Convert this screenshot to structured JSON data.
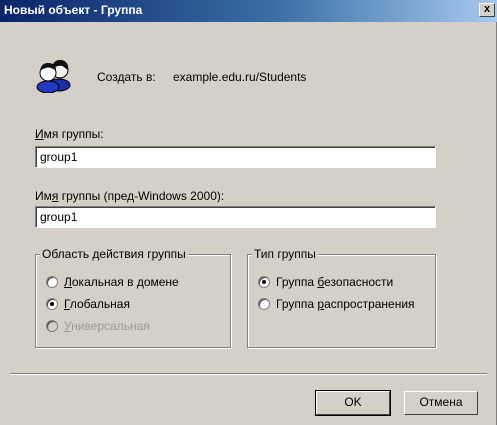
{
  "window": {
    "title": "Новый объект - Группа",
    "close_label": "x"
  },
  "header": {
    "icon": "group-users-icon",
    "create_label": "Создать в:",
    "create_path": "example.edu.ru/Students"
  },
  "fields": {
    "group_name": {
      "label_pre": "",
      "label_ul": "И",
      "label_post": "мя группы:",
      "value": "group1"
    },
    "group_name_legacy": {
      "label_pre": "Им",
      "label_ul": "я",
      "label_post": " группы (пред-Windows 2000):",
      "value": "group1"
    }
  },
  "scope": {
    "legend": "Область действия группы",
    "options": [
      {
        "ul": "Л",
        "rest": "окальная в домене",
        "checked": false,
        "disabled": false
      },
      {
        "ul": "Г",
        "rest": "лобальная",
        "checked": true,
        "disabled": false
      },
      {
        "ul": "У",
        "rest": "ниверсальная",
        "checked": false,
        "disabled": true
      }
    ]
  },
  "type": {
    "legend": "Тип группы",
    "options": [
      {
        "pre": "Группа ",
        "ul": "б",
        "rest": "езопасности",
        "checked": true
      },
      {
        "pre": "Группа ",
        "ul": "р",
        "rest": "аспространения",
        "checked": false
      }
    ]
  },
  "buttons": {
    "ok": "OK",
    "cancel": "Отмена"
  }
}
